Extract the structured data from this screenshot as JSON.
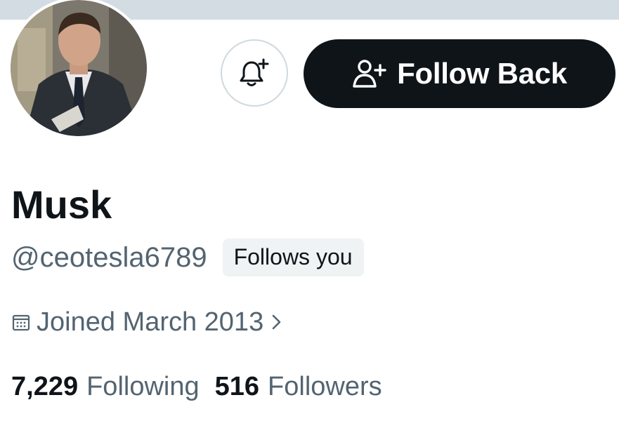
{
  "profile": {
    "display_name": "Musk",
    "handle": "@ceotesla6789",
    "follows_you_badge": "Follows you",
    "joined": "Joined March 2013",
    "following_count": "7,229",
    "following_label": "Following",
    "followers_count": "516",
    "followers_label": "Followers"
  },
  "actions": {
    "notify_icon": "bell-plus-icon",
    "follow_back_label": "Follow Back",
    "follow_icon": "person-plus-icon"
  },
  "colors": {
    "primary_button_bg": "#0f1419",
    "secondary_text": "#536471",
    "badge_bg": "#eff3f4",
    "banner": "#d4dce3"
  }
}
